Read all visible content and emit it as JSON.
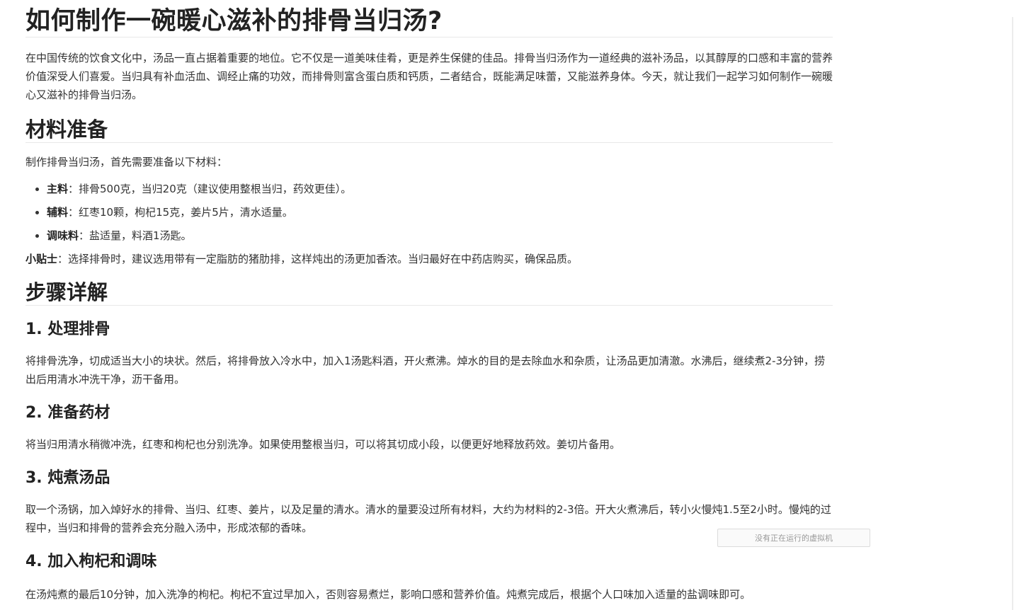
{
  "title": "如何制作一碗暖心滋补的排骨当归汤?",
  "intro": "在中国传统的饮食文化中，汤品一直占据着重要的地位。它不仅是一道美味佳肴，更是养生保健的佳品。排骨当归汤作为一道经典的滋补汤品，以其醇厚的口感和丰富的营养价值深受人们喜爱。当归具有补血活血、调经止痛的功效，而排骨则富含蛋白质和钙质，二者结合，既能满足味蕾，又能滋养身体。今天，就让我们一起学习如何制作一碗暖心又滋补的排骨当归汤。",
  "materials": {
    "heading": "材料准备",
    "intro": "制作排骨当归汤，首先需要准备以下材料：",
    "items": [
      {
        "label": "主料",
        "text": "：排骨500克，当归20克（建议使用整根当归，药效更佳）。"
      },
      {
        "label": "辅料",
        "text": "：红枣10颗，枸杞15克，姜片5片，清水适量。"
      },
      {
        "label": "调味料",
        "text": "：盐适量，料酒1汤匙。"
      }
    ],
    "tip_label": "小贴士",
    "tip_text": "：选择排骨时，建议选用带有一定脂肪的猪肋排，这样炖出的汤更加香浓。当归最好在中药店购买，确保品质。"
  },
  "steps": {
    "heading": "步骤详解",
    "items": [
      {
        "title": "1. 处理排骨",
        "text": "将排骨洗净，切成适当大小的块状。然后，将排骨放入冷水中，加入1汤匙料酒，开火煮沸。焯水的目的是去除血水和杂质，让汤品更加清澈。水沸后，继续煮2-3分钟，捞出后用清水冲洗干净，沥干备用。"
      },
      {
        "title": "2. 准备药材",
        "text": "将当归用清水稍微冲洗，红枣和枸杞也分别洗净。如果使用整根当归，可以将其切成小段，以便更好地释放药效。姜切片备用。"
      },
      {
        "title": "3. 炖煮汤品",
        "text": "取一个汤锅，加入焯好水的排骨、当归、红枣、姜片，以及足量的清水。清水的量要没过所有材料，大约为材料的2-3倍。开大火煮沸后，转小火慢炖1.5至2小时。慢炖的过程中，当归和排骨的营养会充分融入汤中，形成浓郁的香味。"
      },
      {
        "title": "4. 加入枸杞和调味",
        "text": "在汤炖煮的最后10分钟，加入洗净的枸杞。枸杞不宜过早加入，否则容易煮烂，影响口感和营养价值。炖煮完成后，根据个人口味加入适量的盐调味即可。"
      }
    ]
  },
  "vm_status": "没有正在运行的虚拟机"
}
